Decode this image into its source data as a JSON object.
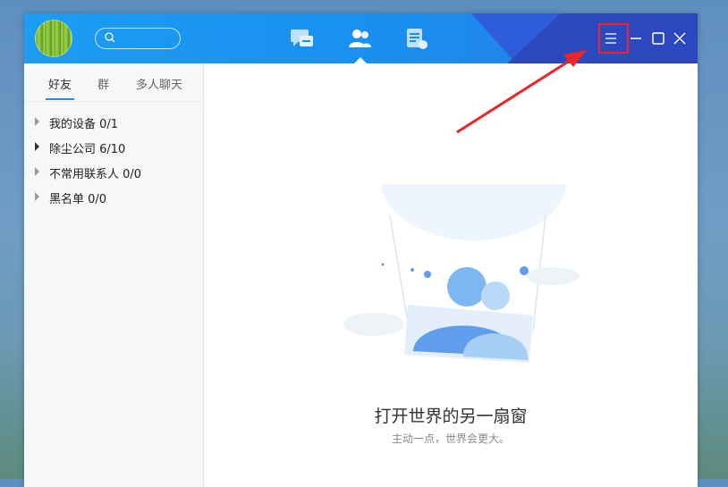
{
  "nav": {
    "tabs": [
      {
        "icon": "message-icon",
        "active": false
      },
      {
        "icon": "contacts-icon",
        "active": true
      },
      {
        "icon": "space-icon",
        "active": false
      }
    ]
  },
  "window_controls": [
    "menu-icon",
    "minimize-icon",
    "maximize-icon",
    "close-icon"
  ],
  "sidebar": {
    "tabs": [
      "好友",
      "群",
      "多人聊天"
    ],
    "active_tab": "好友",
    "groups": [
      {
        "label": "我的设备 0/1",
        "expanded": false
      },
      {
        "label": "除尘公司 6/10",
        "expanded": false
      },
      {
        "label": "不常用联系人 0/0",
        "expanded": false
      },
      {
        "label": "黑名单 0/0",
        "expanded": false
      }
    ]
  },
  "main": {
    "title": "打开世界的另一扇窗",
    "subtitle": "主动一点，世界会更大。"
  },
  "colors": {
    "titlebar": "#1a8ef0",
    "highlight": "#e8262b",
    "accent": "#1a8ef0"
  }
}
